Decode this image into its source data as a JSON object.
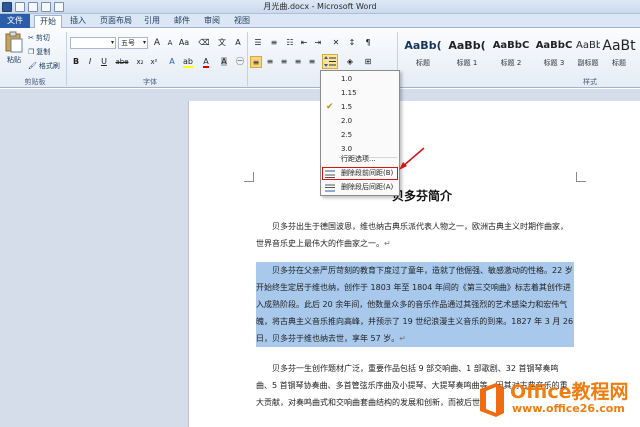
{
  "window": {
    "title": "月光曲.docx - Microsoft Word"
  },
  "tabs": [
    {
      "label": "文件"
    },
    {
      "label": "开始"
    },
    {
      "label": "插入"
    },
    {
      "label": "页面布局"
    },
    {
      "label": "引用"
    },
    {
      "label": "邮件"
    },
    {
      "label": "审阅"
    },
    {
      "label": "视图"
    }
  ],
  "ribbon": {
    "clipboard": {
      "paste": "粘贴",
      "cut": "剪切",
      "copy": "复制",
      "format_painter": "格式刷",
      "label": "剪贴板"
    },
    "font": {
      "name": "",
      "size": "五号",
      "label": "字体",
      "bold": "B",
      "italic": "I",
      "underline": "U",
      "strike": "abe"
    },
    "paragraph": {
      "label": "段落"
    },
    "styles": {
      "label": "样式",
      "items": [
        {
          "sample": "AaBb(",
          "name": "标题"
        },
        {
          "sample": "AaBb(",
          "name": "标题 1"
        },
        {
          "sample": "AaBbC",
          "name": "标题 2"
        },
        {
          "sample": "AaBbC",
          "name": "标题 3"
        },
        {
          "sample": "AaBbC",
          "name": "副标题"
        },
        {
          "sample": "AaBt",
          "name": "标题"
        }
      ]
    }
  },
  "line_spacing_menu": {
    "options": [
      "1.0",
      "1.15",
      "1.5",
      "2.0",
      "2.5",
      "3.0"
    ],
    "selected": "1.5",
    "more": "行距选项...",
    "remove_before": "删除段前间距(B)",
    "remove_after": "删除段后间距(A)"
  },
  "document": {
    "title": "贝多芬简介",
    "para1": "贝多芬出生于德国波恩，维也纳古典乐派代表人物之一，欧洲古典主义时期作曲家，世界音乐史上最伟大的作曲家之一。",
    "para2": "贝多芬在父亲严厉苛刻的教育下度过了童年，造就了他倔强、敏感激动的性格。22 岁开始终生定居于维也纳，创作于 1803 年至 1804 年间的《第三交响曲》标志着其创作进入成熟阶段。此后 20 余年间，他数量众多的音乐作品通过其强烈的艺术感染力和宏伟气魄，将古典主义音乐推向高峰，并预示了 19 世纪浪漫主义音乐的到来。1827 年 3 月 26 日，贝多芬于维也纳去世，享年 57 岁。",
    "para3": "贝多芬一生创作题材广泛，重要作品包括 9 部交响曲、1 部歌剧、32 首钢琴奏鸣曲、5 首钢琴协奏曲、多首管弦乐序曲及小提琴、大提琴奏鸣曲等。因其对古典音乐的重大贡献，对奏鸣曲式和交响曲套曲结构的发展和创新，而被后世尊称为"
  },
  "watermark": {
    "brand": "Office教程网",
    "url": "www.office26.com"
  }
}
